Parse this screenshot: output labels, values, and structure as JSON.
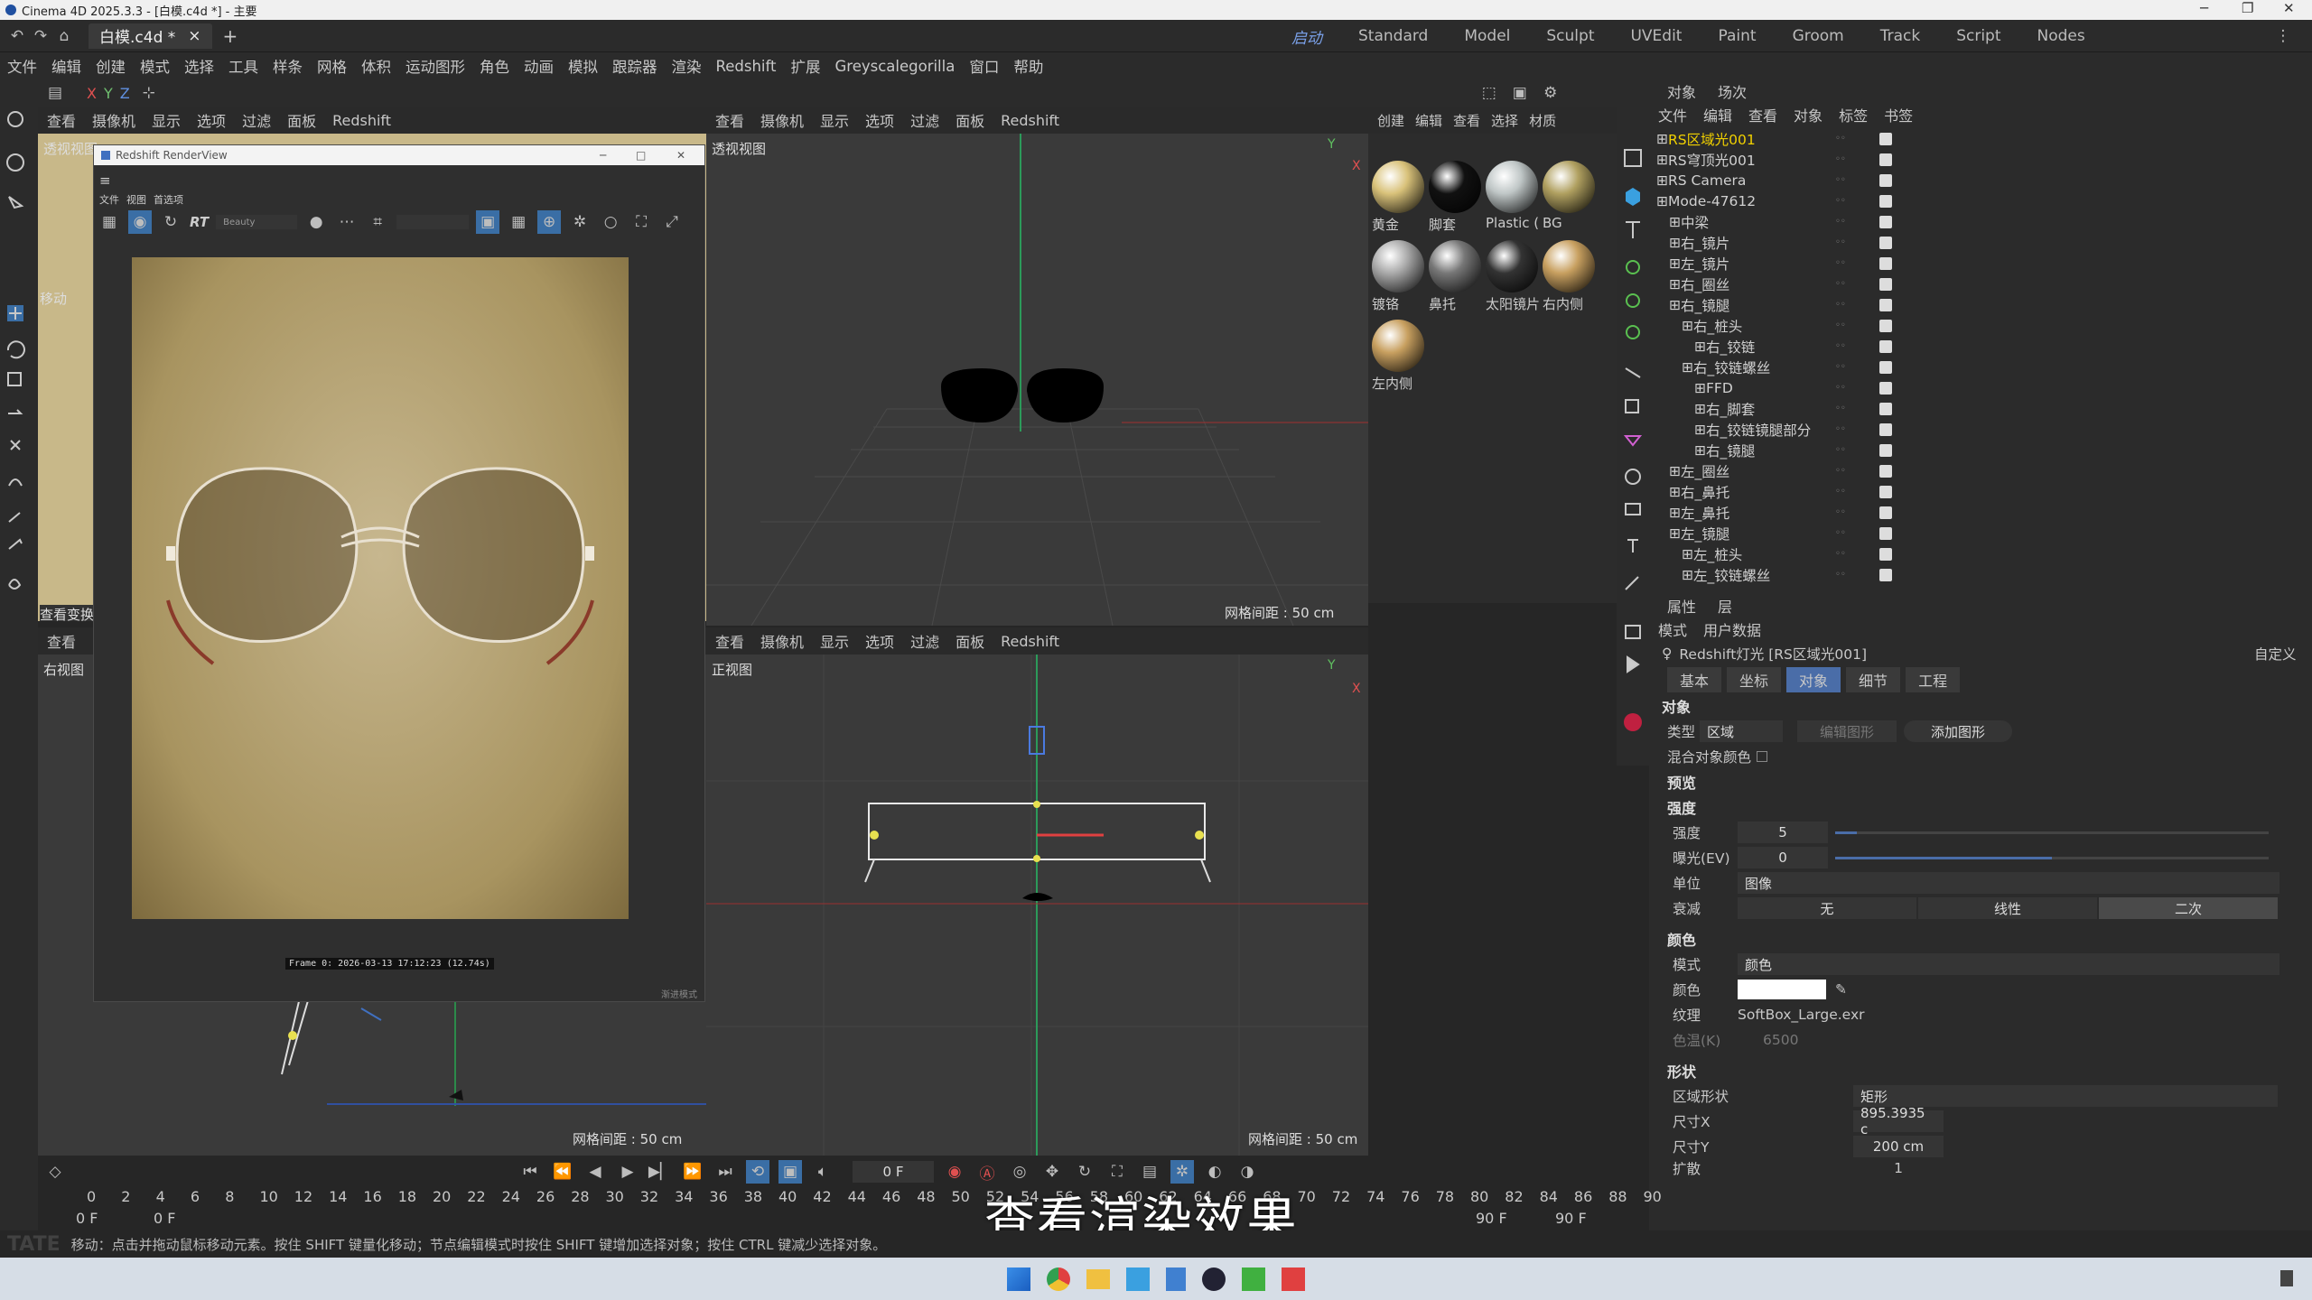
{
  "window": {
    "title": "Cinema 4D 2025.3.3 - [白模.c4d *] - 主要"
  },
  "doc_tab": {
    "label": "白模.c4d *",
    "add": "+"
  },
  "layouts": [
    "启动",
    "Standard",
    "Model",
    "Sculpt",
    "UVEdit",
    "Paint",
    "Groom",
    "Track",
    "Script",
    "Nodes"
  ],
  "menu": [
    "文件",
    "编辑",
    "创建",
    "模式",
    "选择",
    "工具",
    "样条",
    "网格",
    "体积",
    "运动图形",
    "角色",
    "动画",
    "模拟",
    "跟踪器",
    "渲染",
    "Redshift",
    "扩展",
    "Greyscalegorilla",
    "窗口",
    "帮助"
  ],
  "axis_toolbar": {
    "x": "X",
    "y": "Y",
    "z": "Z"
  },
  "viewport_menu": [
    "查看",
    "摄像机",
    "显示",
    "选项",
    "过滤",
    "面板",
    "Redshift"
  ],
  "viewports": {
    "perspective": {
      "label": "透视视图",
      "grid": "网格间距 : 50 cm"
    },
    "front": {
      "label": "正视图",
      "grid": "网格间距 : 50 cm"
    },
    "right": {
      "label": "右视图",
      "grid": "网格间距 : 50 cm"
    },
    "left_top_label": "透视视图",
    "side_labels": {
      "move": "移动",
      "view_transform": "查看变换"
    }
  },
  "render_view": {
    "title": "Redshift RenderView",
    "menu": [
      "文件",
      "视图",
      "首选项"
    ],
    "rt": "RT",
    "aov": "Beauty",
    "frame_info": "Frame  0:  2026-03-13  17:12:23  (12.74s)",
    "footer": "渐进模式"
  },
  "material_manager": {
    "menu": [
      "创建",
      "编辑",
      "查看",
      "选择",
      "材质"
    ],
    "materials": [
      {
        "name": "黄金",
        "color": "#d9c27a"
      },
      {
        "name": "脚套",
        "color": "#111111"
      },
      {
        "name": "Plastic (",
        "color": "#bfc6c6"
      },
      {
        "name": "BG",
        "color": "#b0a060"
      },
      {
        "name": "镀铬",
        "color": "#aaaaaa"
      },
      {
        "name": "鼻托",
        "color": "#777777"
      },
      {
        "name": "太阳镜片",
        "color": "#333333"
      },
      {
        "name": "右内侧",
        "color": "#c8a060"
      },
      {
        "name": "左内侧",
        "color": "#c8a060"
      }
    ]
  },
  "object_manager": {
    "tabs": [
      "对象",
      "场次"
    ],
    "menu": [
      "文件",
      "编辑",
      "查看",
      "对象",
      "标签",
      "书签"
    ],
    "objects": [
      {
        "name": "RS区域光001",
        "indent": 0,
        "highlight": true
      },
      {
        "name": "RS穹顶光001",
        "indent": 0,
        "highlight": false
      },
      {
        "name": "RS Camera",
        "indent": 0,
        "highlight": false
      },
      {
        "name": "Mode-47612",
        "indent": 0,
        "highlight": false
      },
      {
        "name": "中梁",
        "indent": 1,
        "highlight": false
      },
      {
        "name": "右_镜片",
        "indent": 1,
        "highlight": false
      },
      {
        "name": "左_镜片",
        "indent": 1,
        "highlight": false
      },
      {
        "name": "右_圈丝",
        "indent": 1,
        "highlight": false
      },
      {
        "name": "右_镜腿",
        "indent": 1,
        "highlight": false
      },
      {
        "name": "右_桩头",
        "indent": 2,
        "highlight": false
      },
      {
        "name": "右_铰链",
        "indent": 3,
        "highlight": false
      },
      {
        "name": "右_铰链螺丝",
        "indent": 2,
        "highlight": false
      },
      {
        "name": "FFD",
        "indent": 3,
        "highlight": false
      },
      {
        "name": "右_脚套",
        "indent": 3,
        "highlight": false
      },
      {
        "name": "右_铰链镜腿部分",
        "indent": 3,
        "highlight": false
      },
      {
        "name": "右_镜腿",
        "indent": 3,
        "highlight": false
      },
      {
        "name": "左_圈丝",
        "indent": 1,
        "highlight": false
      },
      {
        "name": "右_鼻托",
        "indent": 1,
        "highlight": false
      },
      {
        "name": "左_鼻托",
        "indent": 1,
        "highlight": false
      },
      {
        "name": "左_镜腿",
        "indent": 1,
        "highlight": false
      },
      {
        "name": "左_桩头",
        "indent": 2,
        "highlight": false
      },
      {
        "name": "左_铰链螺丝",
        "indent": 2,
        "highlight": false
      }
    ]
  },
  "attributes": {
    "tabs": [
      "属性",
      "层"
    ],
    "menu": [
      "模式",
      "用户数据"
    ],
    "object_title": "Redshift灯光 [RS区域光001]",
    "preset": "自定义",
    "sub_tabs": [
      "基本",
      "坐标",
      "对象",
      "细节",
      "工程"
    ],
    "active_sub_tab": "对象",
    "section_object": "对象",
    "type_label": "类型",
    "type_value": "区域",
    "edit_shape": "编辑图形",
    "add_shape": "添加图形",
    "mix_color": "混合对象颜色",
    "preview": "预览",
    "intensity_section": "强度",
    "intensity_label": "强度",
    "intensity_value": "5",
    "intensity_fraction": 0.05,
    "exposure_label": "曝光(EV)",
    "exposure_value": "0",
    "exposure_fraction": 0.5,
    "unit_label": "单位",
    "unit_value": "图像",
    "decay_label": "衰减",
    "decay_options": [
      "无",
      "线性",
      "二次"
    ],
    "decay_selected": "二次",
    "color_section": "颜色",
    "mode_label": "模式",
    "mode_value": "颜色",
    "color_label": "颜色",
    "texture_label": "纹理",
    "texture_value": "SoftBox_Large.exr",
    "temp_label": "色温(K)",
    "temp_value": "6500",
    "shape_section": "形状",
    "area_shape_label": "区域形状",
    "area_shape_value": "矩形",
    "size_x_label": "尺寸X",
    "size_x_value": "895.3935 c",
    "size_y_label": "尺寸Y",
    "size_y_value": "200 cm",
    "extend_label": "扩散",
    "extend_value": "1"
  },
  "timeline": {
    "current_frame": "0 F",
    "ticks": [
      "0",
      "2",
      "4",
      "6",
      "8",
      "10",
      "12",
      "14",
      "16",
      "18",
      "20",
      "22",
      "24",
      "26",
      "28",
      "30",
      "32",
      "34",
      "36",
      "38",
      "40",
      "42",
      "44",
      "46",
      "48",
      "50",
      "52",
      "54",
      "56",
      "58",
      "60",
      "62",
      "64",
      "66",
      "68",
      "70",
      "72",
      "74",
      "76",
      "78",
      "80",
      "82",
      "84",
      "86",
      "88",
      "90"
    ],
    "start": "0 F",
    "start2": "0 F",
    "end": "90 F",
    "end2": "90 F"
  },
  "status": "移动：点击并拖动鼠标移动元素。按住 SHIFT 键量化移动；节点编辑模式时按住 SHIFT 键增加选择对象；按住 CTRL 键减少选择对象。",
  "subtitle": "查看渲染效果",
  "watermark": "TATE",
  "colors": {
    "accent": "#3a6ea5",
    "highlight_text": "#f0d000",
    "active_tab": "#4a6da8"
  }
}
